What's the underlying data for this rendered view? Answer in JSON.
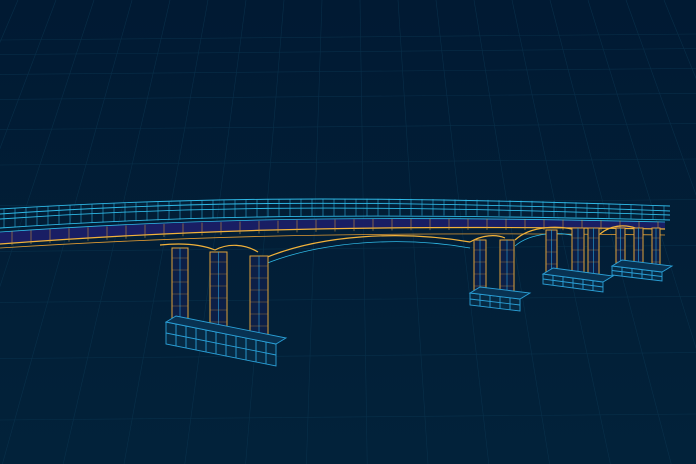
{
  "scene": {
    "subject": "bridge-wireframe",
    "colors": {
      "background_top": "#011a33",
      "background_bottom": "#02223a",
      "grid": "#0b3550",
      "railing": "#2fb9e6",
      "deck_band": "#1a1f66",
      "deck_edge": "#f2b23a",
      "pier": "#e0a23a",
      "pier_edge": "#2aa6e0",
      "footing": "#2a9fd6"
    }
  }
}
